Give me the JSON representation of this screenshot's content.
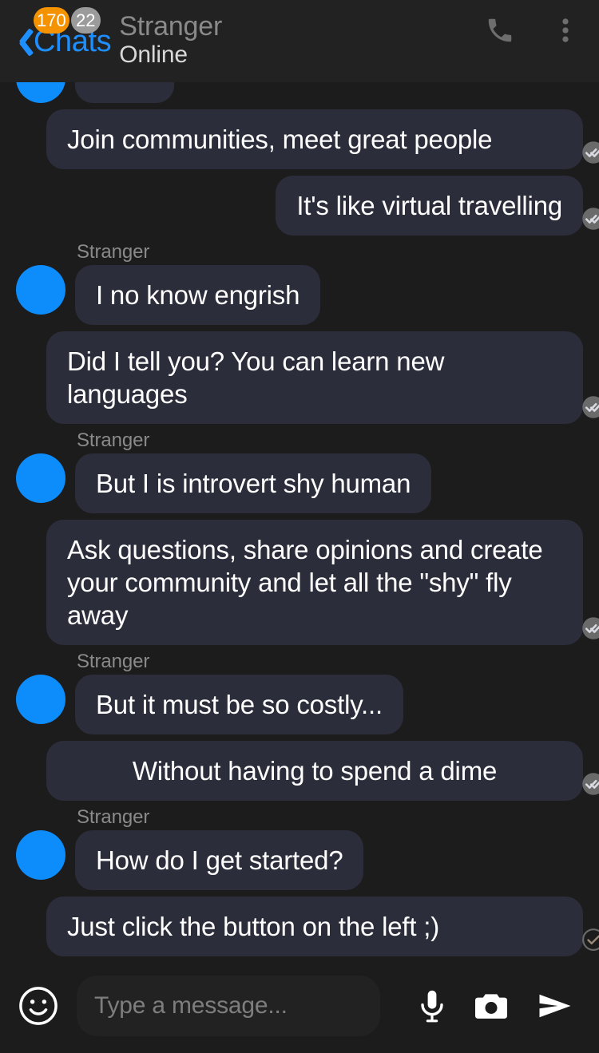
{
  "header": {
    "back_label": "Chats",
    "back_icon": "chevron-left-icon",
    "badges": [
      {
        "count": "170",
        "color": "#f49200"
      },
      {
        "count": "22",
        "color": "#9b9b9b"
      }
    ],
    "peer_name": "Stranger",
    "peer_status": "Online",
    "call_icon": "phone-icon",
    "menu_icon": "more-vertical-icon"
  },
  "chat": {
    "messages": [
      {
        "id": "m0",
        "side": "in",
        "partial": true,
        "text": ""
      },
      {
        "id": "m1",
        "side": "out",
        "text": "Join communities, meet great people",
        "status": "read",
        "status_icon": "double-check-filled-icon"
      },
      {
        "id": "m2",
        "side": "out",
        "text": "It's like virtual travelling",
        "status": "read",
        "status_icon": "double-check-filled-icon"
      },
      {
        "id": "m3",
        "side": "in",
        "sender": "Stranger",
        "text": "I no know engrish"
      },
      {
        "id": "m4",
        "side": "out",
        "text": "Did I tell you? You can learn new languages",
        "status": "read",
        "status_icon": "double-check-filled-icon"
      },
      {
        "id": "m5",
        "side": "in",
        "sender": "Stranger",
        "text": "But I is introvert shy human"
      },
      {
        "id": "m6",
        "side": "out",
        "text": "Ask questions, share opinions and create your community and let all the \"shy\" fly away",
        "status": "read",
        "status_icon": "double-check-filled-icon"
      },
      {
        "id": "m7",
        "side": "in",
        "sender": "Stranger",
        "text": "But it must be so costly..."
      },
      {
        "id": "m8",
        "side": "out",
        "text": "Without having to spend a dime",
        "status": "read",
        "status_icon": "double-check-filled-icon"
      },
      {
        "id": "m9",
        "side": "in",
        "sender": "Stranger",
        "text": "How do I get started?"
      },
      {
        "id": "m10",
        "side": "out",
        "text": "Just click the button on the left ;)",
        "status": "sent",
        "status_icon": "check-circle-outline-icon"
      }
    ]
  },
  "composer": {
    "emoji_icon": "smiley-icon",
    "placeholder": "Type a message...",
    "value": "",
    "mic_icon": "microphone-icon",
    "camera_icon": "camera-icon",
    "send_icon": "send-icon"
  },
  "colors": {
    "background": "#1c1c1c",
    "header_bg": "#222222",
    "bubble": "#2b2d3a",
    "accent_blue": "#1e8fff",
    "avatar_blue": "#0d8cfb",
    "badge_orange": "#f49200",
    "badge_grey": "#9b9b9b",
    "text_primary": "#ffffff",
    "text_muted": "#8a8a8a"
  }
}
